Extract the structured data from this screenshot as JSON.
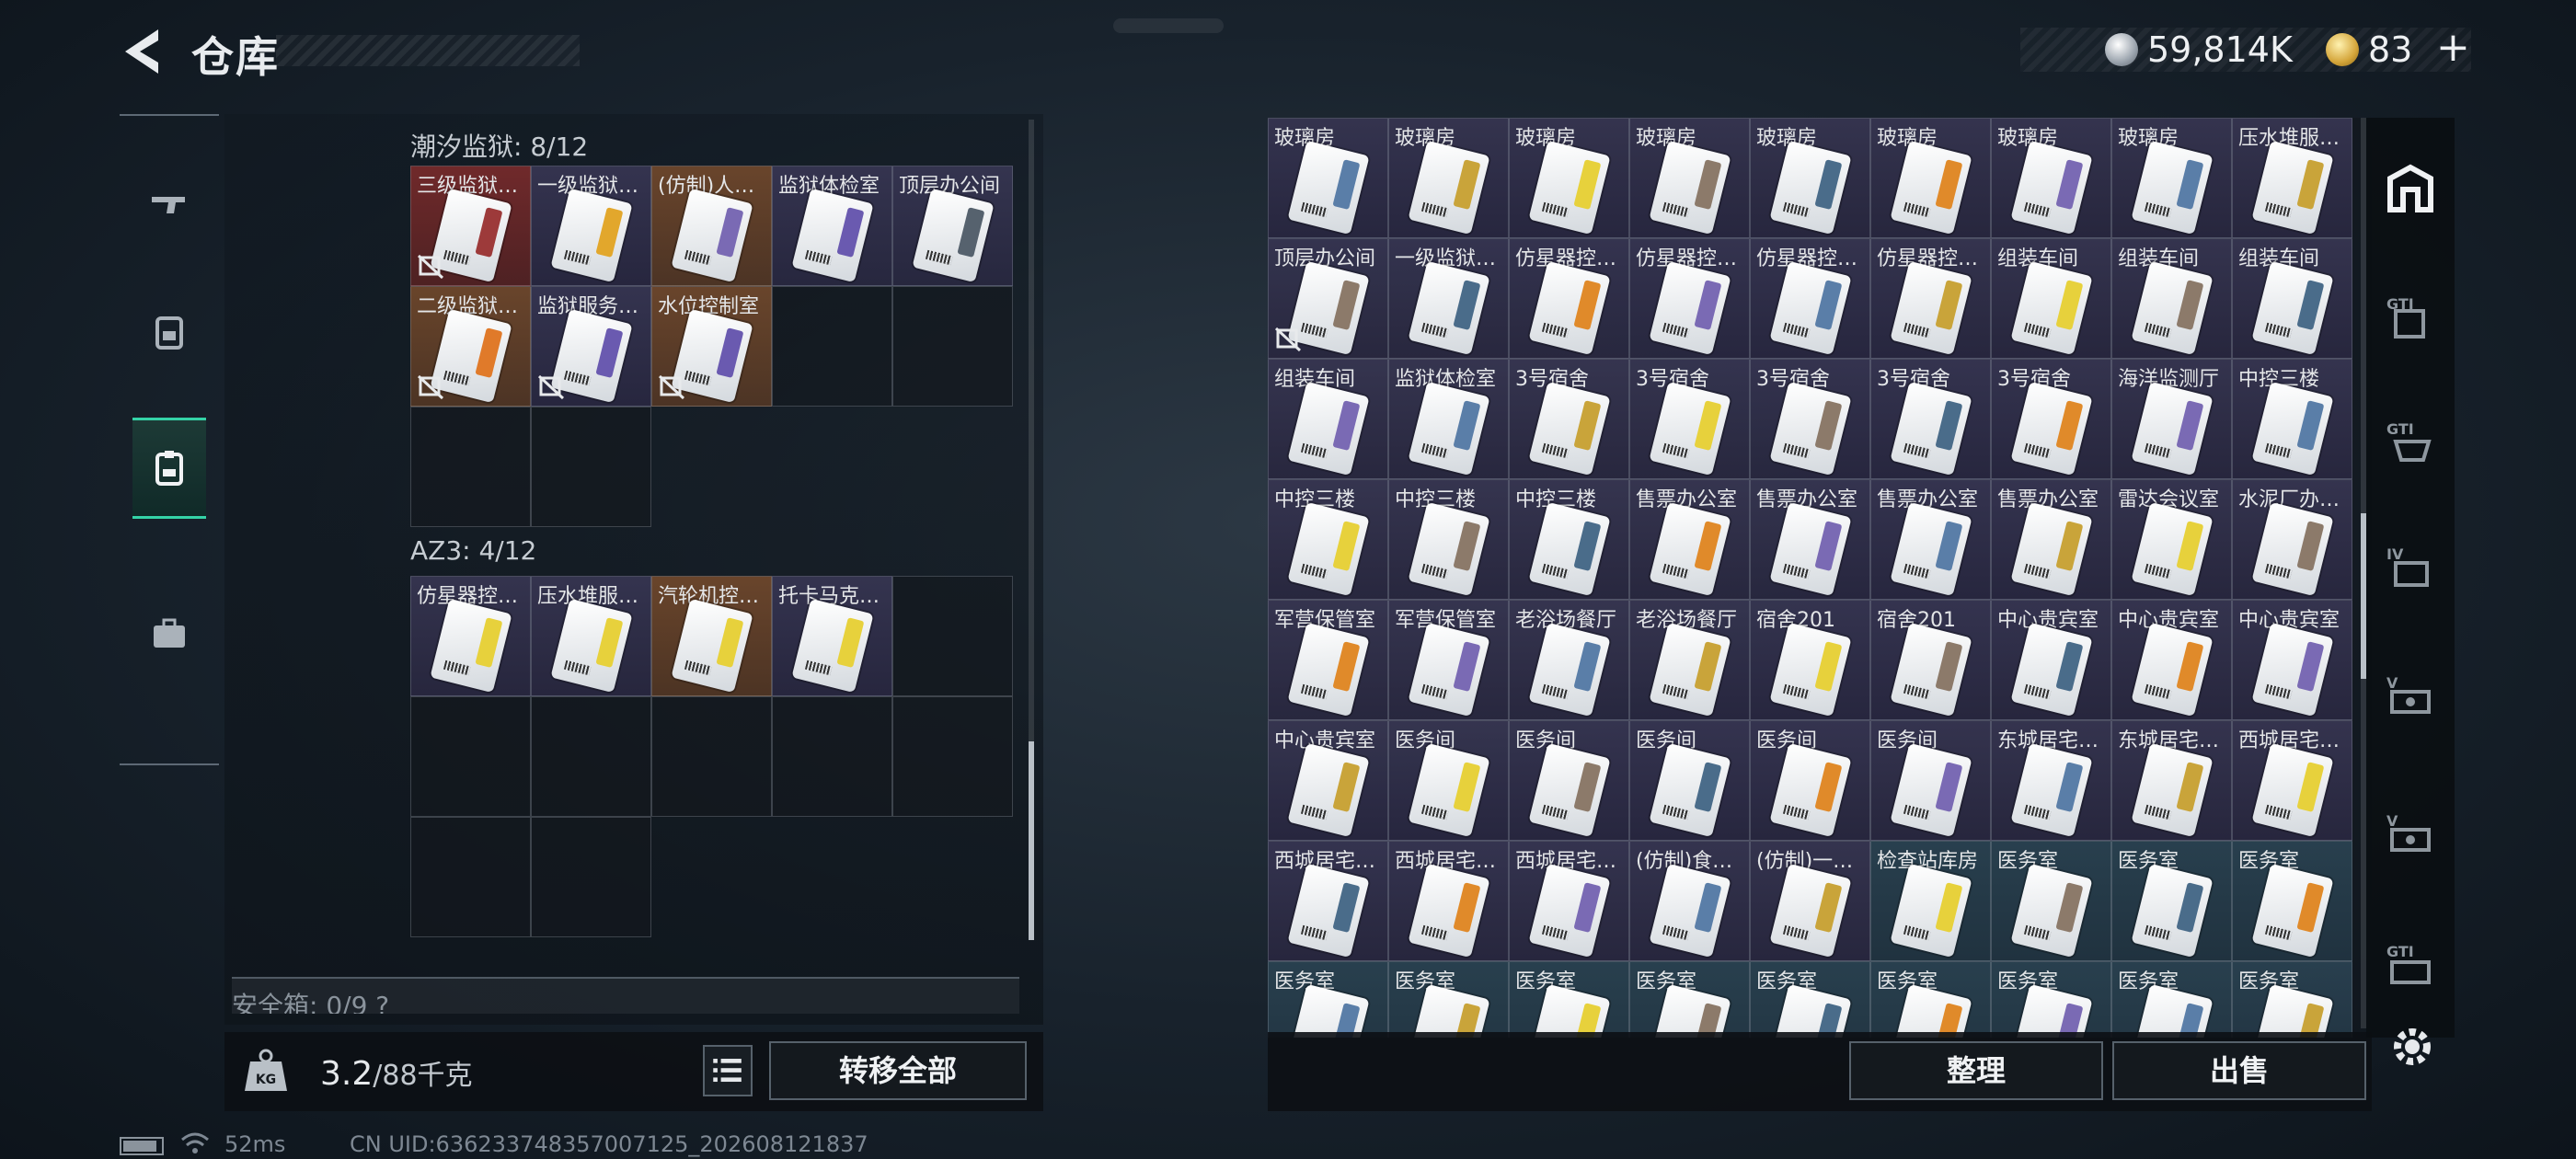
{
  "header": {
    "title": "仓库",
    "currency_silver": "59,814K",
    "currency_gold": "83",
    "plus": "+"
  },
  "left_tabs": [
    {
      "name": "weapons",
      "active": false
    },
    {
      "name": "armor",
      "active": false
    },
    {
      "name": "keycards",
      "active": true
    },
    {
      "name": "supplies",
      "active": false
    }
  ],
  "sections": [
    {
      "title": "潮汐监狱: 8/12",
      "cells": [
        {
          "label": "三级监狱…",
          "rarity": "red",
          "stripe": "#9d3a3a",
          "nobind": true
        },
        {
          "label": "一级监狱…",
          "rarity": "purple",
          "stripe": "#e2a72c",
          "nobind": false
        },
        {
          "label": "(仿制)人…",
          "rarity": "orange",
          "stripe": "#7a6ab4",
          "nobind": false
        },
        {
          "label": "监狱体检室",
          "rarity": "purple",
          "stripe": "#6a5ab0",
          "nobind": false
        },
        {
          "label": "顶层办公间",
          "rarity": "purple",
          "stripe": "#56626e",
          "nobind": false
        },
        {
          "label": "二级监狱…",
          "rarity": "orange",
          "stripe": "#e07a2a",
          "nobind": true
        },
        {
          "label": "监狱服务…",
          "rarity": "purple",
          "stripe": "#6a5ab0",
          "nobind": true
        },
        {
          "label": "水位控制室",
          "rarity": "orange",
          "stripe": "#6a5ab0",
          "nobind": true
        }
      ]
    },
    {
      "title": "AZ3: 4/12",
      "cells": [
        {
          "label": "仿星器控…",
          "rarity": "purple",
          "stripe": "#e7d13c",
          "nobind": false
        },
        {
          "label": "压水堆服…",
          "rarity": "purple",
          "stripe": "#e7d13c",
          "nobind": false
        },
        {
          "label": "汽轮机控…",
          "rarity": "orange",
          "stripe": "#e7d13c",
          "nobind": false
        },
        {
          "label": "托卡马克…",
          "rarity": "purple",
          "stripe": "#e7d13c",
          "nobind": false
        }
      ]
    }
  ],
  "safebox": "安全箱: 0/9 ?",
  "weight": {
    "current": "3.2",
    "max": "/88千克",
    "unit_icon": "KG"
  },
  "buttons": {
    "transfer_all": "转移全部",
    "organize": "整理",
    "sell": "出售"
  },
  "status": {
    "ping": "52ms",
    "uid": "CN UID:6362337483570071​25_202608121837"
  },
  "right_rows": [
    {
      "labels": [
        "玻璃房",
        "玻璃房",
        "玻璃房",
        "玻璃房",
        "玻璃房",
        "玻璃房",
        "玻璃房",
        "玻璃房",
        "压水堆服…"
      ],
      "tone": "purple"
    },
    {
      "labels": [
        "顶层办公间",
        "一级监狱…",
        "仿星器控…",
        "仿星器控…",
        "仿星器控…",
        "仿星器控…",
        "组装车间",
        "组装车间",
        "组装车间"
      ],
      "tone": "purple"
    },
    {
      "labels": [
        "组装车间",
        "监狱体检室",
        "3号宿舍",
        "3号宿舍",
        "3号宿舍",
        "3号宿舍",
        "3号宿舍",
        "海洋监测厅",
        "中控三楼"
      ],
      "tone": "purple"
    },
    {
      "labels": [
        "中控三楼",
        "中控三楼",
        "中控三楼",
        "售票办公室",
        "售票办公室",
        "售票办公室",
        "售票办公室",
        "雷达会议室",
        "水泥厂办…"
      ],
      "tone": "purple"
    },
    {
      "labels": [
        "军营保管室",
        "军营保管室",
        "老浴场餐厅",
        "老浴场餐厅",
        "宿舍201",
        "宿舍201",
        "中心贵宾室",
        "中心贵宾室",
        "中心贵宾室"
      ],
      "tone": "purple"
    },
    {
      "labels": [
        "中心贵宾室",
        "医务间",
        "医务间",
        "医务间",
        "医务间",
        "医务间",
        "东城居宅…",
        "东城居宅…",
        "西城居宅…"
      ],
      "tone": "purple"
    },
    {
      "labels": [
        "西城居宅…",
        "西城居宅…",
        "西城居宅…",
        "(仿制)食…",
        "(仿制)一…",
        "检查站库房",
        "医务室",
        "医务室",
        "医务室"
      ],
      "tone": "mixed"
    },
    {
      "labels": [
        "医务室",
        "医务室",
        "医务室",
        "医务室",
        "医务室",
        "医务室",
        "医务室",
        "医务室",
        "医务室"
      ],
      "tone": "blue"
    }
  ],
  "right_filters": [
    "all-items",
    "gti-map-1",
    "gti-map-2",
    "iv-map",
    "v-map-1",
    "v-map-2",
    "gti-map-3"
  ],
  "colors": {
    "accent": "#34d3a7",
    "gold": "#d4a53a"
  }
}
